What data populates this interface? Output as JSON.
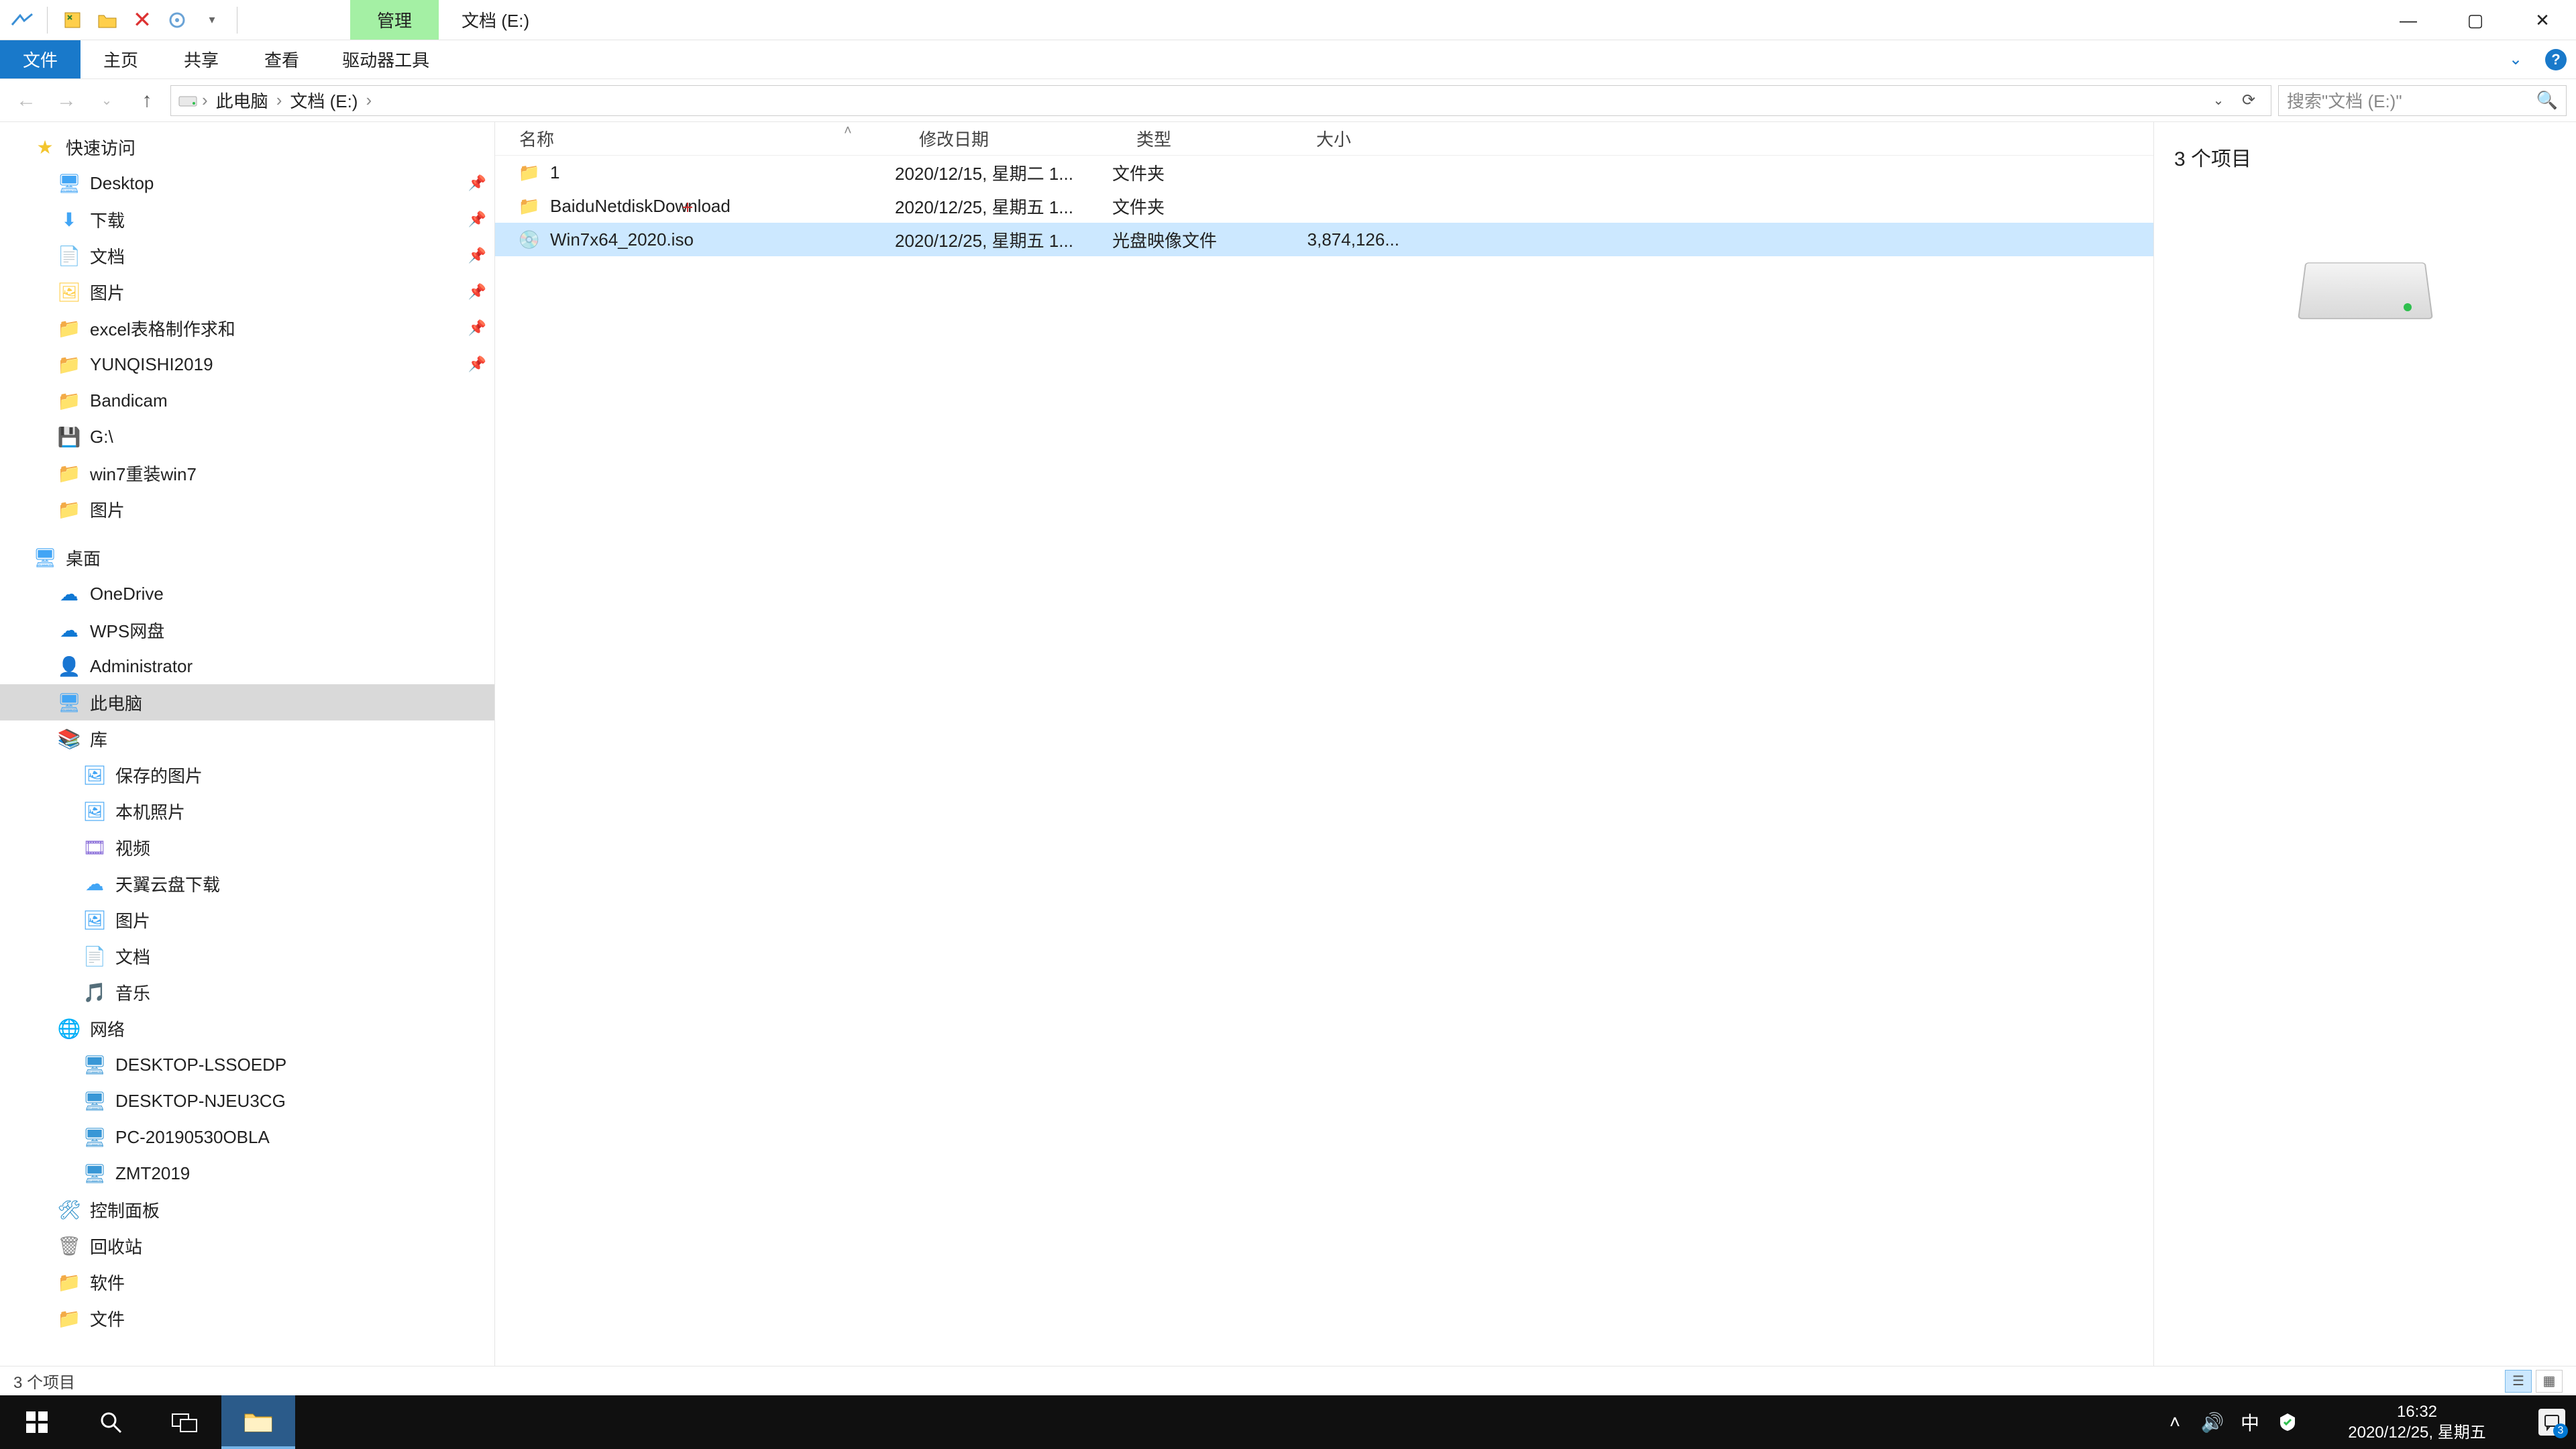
{
  "titlebar": {
    "context_tab": "管理",
    "title": "文档 (E:)"
  },
  "ribbon": {
    "file": "文件",
    "home": "主页",
    "share": "共享",
    "view": "查看",
    "drive_tools": "驱动器工具"
  },
  "breadcrumb": {
    "root": "此电脑",
    "current": "文档 (E:)"
  },
  "search": {
    "placeholder": "搜索\"文档 (E:)\""
  },
  "cols": {
    "name": "名称",
    "date": "修改日期",
    "type": "类型",
    "size": "大小"
  },
  "file_rows": [
    {
      "name": "1",
      "date": "2020/12/15, 星期二 1...",
      "type": "文件夹",
      "size": "",
      "icon": "folder"
    },
    {
      "name": "BaiduNetdiskDownload",
      "date": "2020/12/25, 星期五 1...",
      "type": "文件夹",
      "size": "",
      "icon": "folder"
    },
    {
      "name": "Win7x64_2020.iso",
      "date": "2020/12/25, 星期五 1...",
      "type": "光盘映像文件",
      "size": "3,874,126...",
      "icon": "iso"
    }
  ],
  "preview": {
    "summary": "3 个项目"
  },
  "status": {
    "text": "3 个项目"
  },
  "sidebar": {
    "quick_access": "快速访问",
    "quick": [
      {
        "label": "Desktop",
        "icon": "🖥",
        "cls": "c-blue",
        "pin": true
      },
      {
        "label": "下载",
        "icon": "⬇",
        "cls": "c-blue",
        "pin": true
      },
      {
        "label": "文档",
        "icon": "📄",
        "cls": "c-folder",
        "pin": true
      },
      {
        "label": "图片",
        "icon": "🖼",
        "cls": "c-folder",
        "pin": true
      },
      {
        "label": "excel表格制作求和",
        "icon": "📁",
        "cls": "c-folder",
        "pin": true
      },
      {
        "label": "YUNQISHI2019",
        "icon": "📁",
        "cls": "c-blue",
        "pin": true
      },
      {
        "label": "Bandicam",
        "icon": "📁",
        "cls": "c-folder",
        "pin": false
      },
      {
        "label": "G:\\",
        "icon": "💾",
        "cls": "c-blue",
        "pin": false
      },
      {
        "label": "win7重装win7",
        "icon": "📁",
        "cls": "c-folder",
        "pin": false
      },
      {
        "label": "图片",
        "icon": "📁",
        "cls": "c-folder",
        "pin": false
      }
    ],
    "desktop": "桌面",
    "desktop_items": [
      {
        "label": "OneDrive",
        "icon": "☁",
        "cls": "c-onedrive"
      },
      {
        "label": "WPS网盘",
        "icon": "☁",
        "cls": "c-wps"
      },
      {
        "label": "Administrator",
        "icon": "👤",
        "cls": "c-green"
      },
      {
        "label": "此电脑",
        "icon": "🖥",
        "cls": "c-pc",
        "selected": true
      },
      {
        "label": "库",
        "icon": "📚",
        "cls": "c-lib"
      }
    ],
    "libs": [
      {
        "label": "保存的图片",
        "icon": "🖼",
        "cls": "c-blue"
      },
      {
        "label": "本机照片",
        "icon": "🖼",
        "cls": "c-blue"
      },
      {
        "label": "视频",
        "icon": "🎞",
        "cls": "c-purple"
      },
      {
        "label": "天翼云盘下载",
        "icon": "☁",
        "cls": "c-blue"
      },
      {
        "label": "图片",
        "icon": "🖼",
        "cls": "c-blue"
      },
      {
        "label": "文档",
        "icon": "📄",
        "cls": "c-folder"
      },
      {
        "label": "音乐",
        "icon": "🎵",
        "cls": "c-blue"
      }
    ],
    "network": "网络",
    "net_items": [
      {
        "label": "DESKTOP-LSSOEDP",
        "icon": "🖥",
        "cls": "c-net"
      },
      {
        "label": "DESKTOP-NJEU3CG",
        "icon": "🖥",
        "cls": "c-net"
      },
      {
        "label": "PC-20190530OBLA",
        "icon": "🖥",
        "cls": "c-net"
      },
      {
        "label": "ZMT2019",
        "icon": "🖥",
        "cls": "c-net"
      }
    ],
    "tail": [
      {
        "label": "控制面板",
        "icon": "🛠",
        "cls": "c-cp"
      },
      {
        "label": "回收站",
        "icon": "🗑",
        "cls": "c-rec"
      },
      {
        "label": "软件",
        "icon": "📁",
        "cls": "c-folder"
      },
      {
        "label": "文件",
        "icon": "📁",
        "cls": "c-folder"
      }
    ]
  },
  "clock": {
    "time": "16:32",
    "date": "2020/12/25, 星期五"
  },
  "tray": {
    "ime": "中",
    "notif_count": "3"
  }
}
